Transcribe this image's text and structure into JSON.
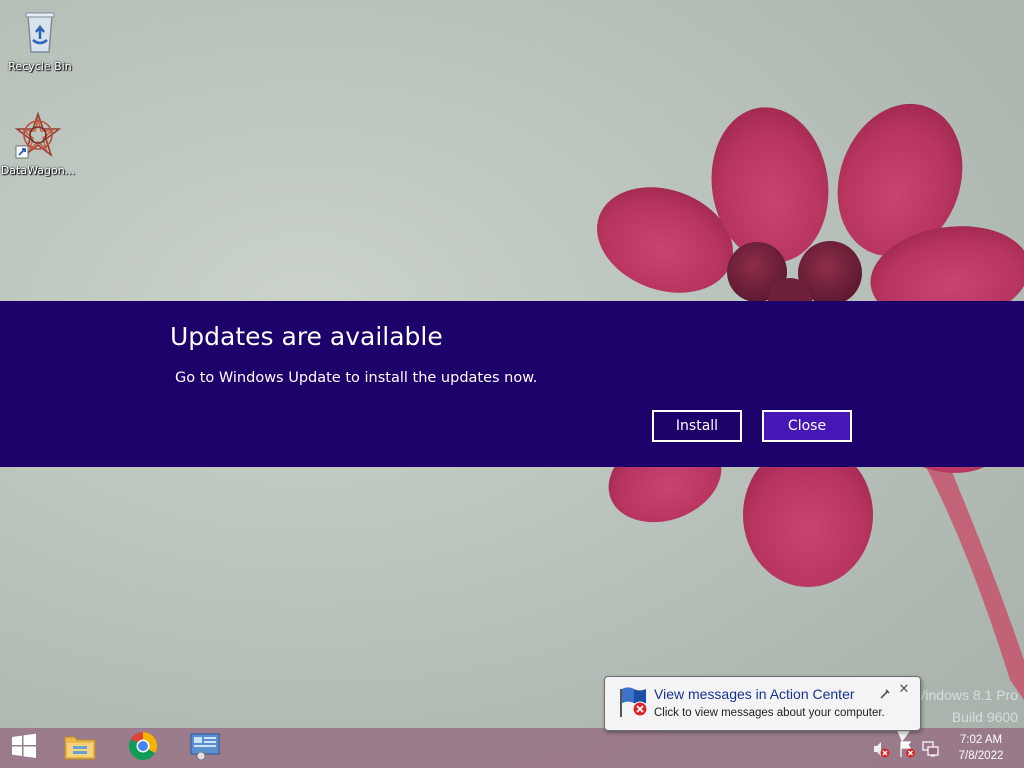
{
  "desktop": {
    "icons": [
      {
        "label": "Recycle Bin",
        "icon": "recycle-bin-icon"
      },
      {
        "label": "DataWagon...",
        "icon": "datawagon-icon"
      }
    ],
    "watermark": {
      "line1": "Windows 8.1 Pro",
      "line2": "Build 9600"
    }
  },
  "banner": {
    "title": "Updates are available",
    "message": "Go to Windows Update to install the updates now.",
    "install_label": "Install",
    "close_label": "Close",
    "background_color": "#1d016b",
    "close_button_color": "#4617b4"
  },
  "balloon": {
    "title": "View messages in Action Center",
    "text": "Click to view messages about your computer.",
    "close_glyph": "✕"
  },
  "taskbar": {
    "pinned": [
      "start-icon",
      "file-explorer-icon",
      "chrome-icon",
      "control-panel-icon"
    ],
    "tray": [
      "volume-muted-icon",
      "action-center-error-icon",
      "network-icon"
    ],
    "clock": {
      "time": "7:02 AM",
      "date": "7/8/2022"
    }
  }
}
